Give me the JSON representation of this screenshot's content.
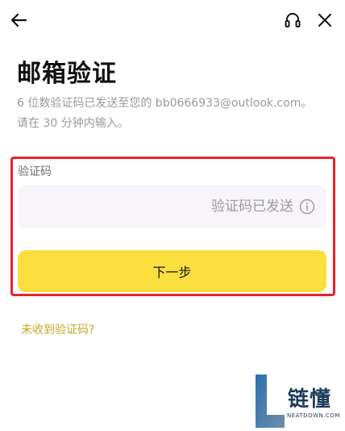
{
  "header": {
    "back_icon": "arrow-left-icon",
    "support_icon": "headset-icon",
    "close_icon": "close-icon"
  },
  "page": {
    "title": "邮箱验证",
    "subtitle_line1": "6 位数验证码已发送至您的 bb0666933@outlook.com。",
    "subtitle_line2": "请在 30 分钟内输入。"
  },
  "form": {
    "label": "验证码",
    "code_value": "",
    "status_text": "验证码已发送",
    "info_icon": "info-icon",
    "next_button": "下一步"
  },
  "resend_link": "未收到验证码?",
  "watermark": {
    "text": "链懂",
    "sub": "NEATDOWN.COM"
  },
  "colors": {
    "accent_yellow": "#fbdf3e",
    "link_gold": "#c7a622",
    "highlight_red": "#e8232b",
    "input_bg": "#f8f5fa"
  }
}
